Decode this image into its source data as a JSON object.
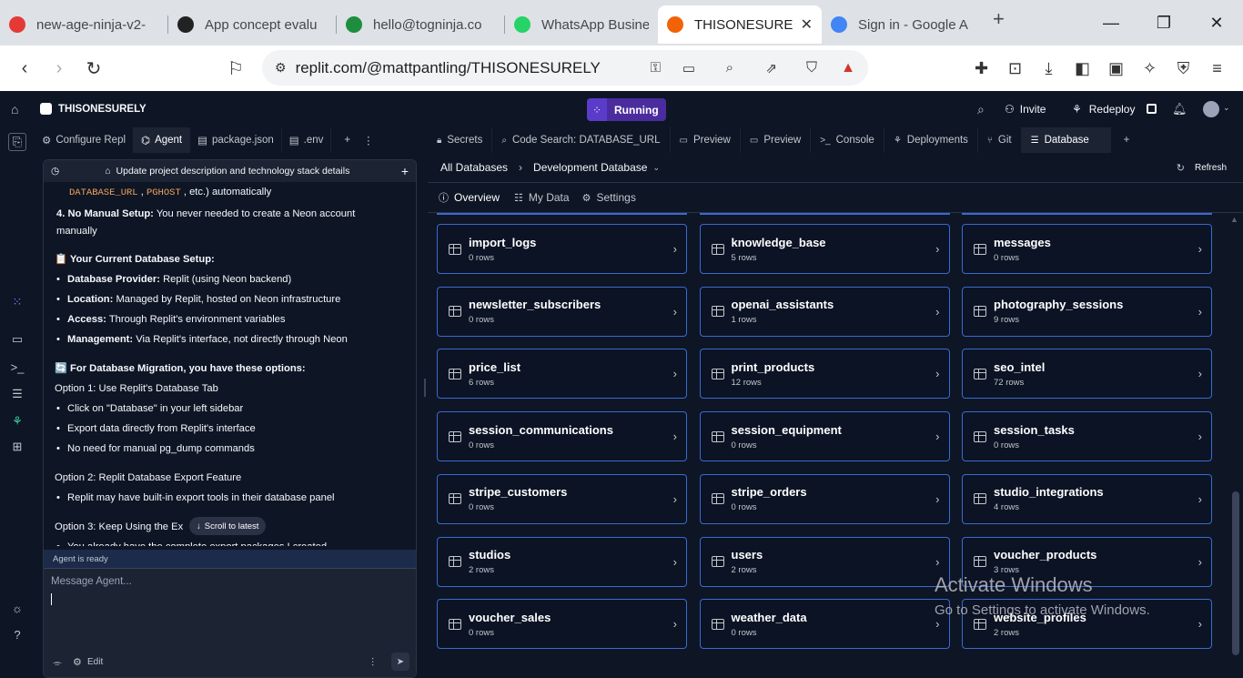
{
  "browser": {
    "tabs": [
      {
        "title": "new-age-ninja-v2-",
        "color": "#e53935"
      },
      {
        "title": "App concept evalu",
        "color": "#222222"
      },
      {
        "title": "hello@togninja.co",
        "color": "#1e8e3e"
      },
      {
        "title": "WhatsApp Busines",
        "color": "#25d366"
      },
      {
        "title": "THISONESUREL",
        "color": "#f26207"
      },
      {
        "title": "Sign in - Google A",
        "color": "#4285f4"
      }
    ],
    "url": "replit.com/@mattpantling/THISONESURELY"
  },
  "topbar": {
    "project_name": "THISONESURELY",
    "run_label": "Running",
    "invite_label": "Invite",
    "redeploy_label": "Redeploy"
  },
  "left_tabs": [
    "Configure Repl",
    "Agent",
    "package.json",
    ".env"
  ],
  "agent": {
    "header": "Update project description and technology stack details",
    "lines": [
      {
        "type": "code",
        "parts": [
          "DATABASE_URL",
          " , ",
          "PGHOST",
          " , etc.) automatically"
        ]
      },
      {
        "type": "num",
        "b": "4. No Manual Setup:",
        "t": " You never needed to create a Neon account manually"
      },
      {
        "type": "head",
        "t": "📋 Your Current Database Setup:"
      },
      {
        "type": "li",
        "b": "Database Provider:",
        "t": " Replit (using Neon backend)"
      },
      {
        "type": "li",
        "b": "Location:",
        "t": " Managed by Replit, hosted on Neon infrastructure"
      },
      {
        "type": "li",
        "b": "Access:",
        "t": " Through Replit's environment variables"
      },
      {
        "type": "li",
        "b": "Management:",
        "t": " Via Replit's interface, not directly through Neon"
      },
      {
        "type": "head",
        "t": "🔄 For Database Migration, you have these options:"
      },
      {
        "type": "p",
        "t": "Option 1: Use Replit's Database Tab"
      },
      {
        "type": "li",
        "b": "",
        "t": "Click on \"Database\" in your left sidebar"
      },
      {
        "type": "li",
        "b": "",
        "t": "Export data directly from Replit's interface"
      },
      {
        "type": "li",
        "b": "",
        "t": "No need for manual pg_dump commands"
      },
      {
        "type": "p",
        "t": "Option 2: Replit Database Export Feature"
      },
      {
        "type": "li",
        "b": "",
        "t": "Replit may have built-in export tools in their database panel"
      },
      {
        "type": "p",
        "t": "Option 3: Keep Using the Ex"
      },
      {
        "type": "li",
        "b": "",
        "t": "You already have the complete export packages I created"
      }
    ],
    "scroll_latest": "Scroll to latest",
    "status": "Agent is ready",
    "placeholder": "Message Agent...",
    "edit_label": "Edit"
  },
  "right_tabs": [
    "Secrets",
    "Code Search: DATABASE_URL",
    "Preview",
    "Preview",
    "Console",
    "Deployments",
    "Git",
    "Database"
  ],
  "database": {
    "breadcrumb_root": "All Databases",
    "breadcrumb_current": "Development Database",
    "refresh_label": "Refresh",
    "subtabs": [
      "Overview",
      "My Data",
      "Settings"
    ],
    "tables": [
      {
        "name": "import_logs",
        "rows": "0 rows"
      },
      {
        "name": "knowledge_base",
        "rows": "5 rows"
      },
      {
        "name": "messages",
        "rows": "0 rows"
      },
      {
        "name": "newsletter_subscribers",
        "rows": "0 rows"
      },
      {
        "name": "openai_assistants",
        "rows": "1 rows"
      },
      {
        "name": "photography_sessions",
        "rows": "9 rows"
      },
      {
        "name": "price_list",
        "rows": "6 rows"
      },
      {
        "name": "print_products",
        "rows": "12 rows"
      },
      {
        "name": "seo_intel",
        "rows": "72 rows"
      },
      {
        "name": "session_communications",
        "rows": "0 rows"
      },
      {
        "name": "session_equipment",
        "rows": "0 rows"
      },
      {
        "name": "session_tasks",
        "rows": "0 rows"
      },
      {
        "name": "stripe_customers",
        "rows": "0 rows"
      },
      {
        "name": "stripe_orders",
        "rows": "0 rows"
      },
      {
        "name": "studio_integrations",
        "rows": "4 rows"
      },
      {
        "name": "studios",
        "rows": "2 rows"
      },
      {
        "name": "users",
        "rows": "2 rows"
      },
      {
        "name": "voucher_products",
        "rows": "3 rows"
      },
      {
        "name": "voucher_sales",
        "rows": "0 rows"
      },
      {
        "name": "weather_data",
        "rows": "0 rows"
      },
      {
        "name": "website_profiles",
        "rows": "2 rows"
      }
    ]
  },
  "watermark": {
    "line1": "Activate Windows",
    "line2": "Go to Settings to activate Windows."
  }
}
